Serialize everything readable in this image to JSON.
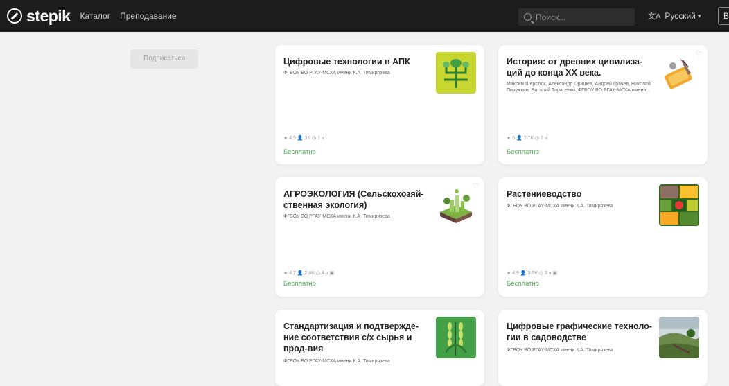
{
  "header": {
    "logo": "stepik",
    "nav": [
      "Каталог",
      "Преподавание"
    ],
    "search_placeholder": "Поиск...",
    "language": "Русский",
    "right_button": "В"
  },
  "sidebar": {
    "subscribe_label": "Подписаться"
  },
  "cards": [
    {
      "title": "Цифровые технологии в АПК",
      "authors": "ФГБОУ ВО РГАУ-МСХА имени К.А. Тимирязева",
      "stats": "★ 4.9   👤 3K   ◷ 1 ч",
      "price": "Бесплатно",
      "thumb": "circuit-plant"
    },
    {
      "title": "История: от древних цивилиза-ций до конца XX века.",
      "authors": "Максим Шерстюк, Александр Оришев, Андрей Грачев, Николай Пичужкин, Виталий Тарасенко, ФГБОУ ВО РГАУ-МСХА имени...",
      "stats": "★ 5   👤 2.7K   ◷ 2 ч",
      "price": "Бесплатно",
      "thumb": "quill-scroll"
    },
    {
      "title": "АГРОЭКОЛОГИЯ (Сельскохозяй-ственная экология)",
      "authors": "ФГБОУ ВО РГАУ-МСХА имени К.А. Тимирязева",
      "stats": "★ 4.7   👤 2.4K   ◷ 4 ч   ▣",
      "price": "Бесплатно",
      "thumb": "green-city"
    },
    {
      "title": "Растениеводство",
      "authors": "ФГБОУ ВО РГАУ-МСХА имени К.А. Тимирязева",
      "stats": "★ 4.9   👤 3.3K   ◷ 3 ч   ▣",
      "price": "Бесплатно",
      "thumb": "crops-collage"
    },
    {
      "title": "Стандартизация и подтвержде-ние соответствия с/х сырья и прод-вия",
      "authors": "ФГБОУ ВО РГАУ-МСХА имени К.А. Тимирязева",
      "stats": "",
      "price": "",
      "thumb": "wheat"
    },
    {
      "title": "Цифровые графические техноло-гии в садоводстве",
      "authors": "ФГБОУ ВО РГАУ-МСХА имени К.А. Тимирязева",
      "stats": "",
      "price": "",
      "thumb": "landscape"
    }
  ],
  "colors": {
    "topbar": "#1c1c1c",
    "price_green": "#4caf50",
    "background": "#f2f2f2"
  }
}
